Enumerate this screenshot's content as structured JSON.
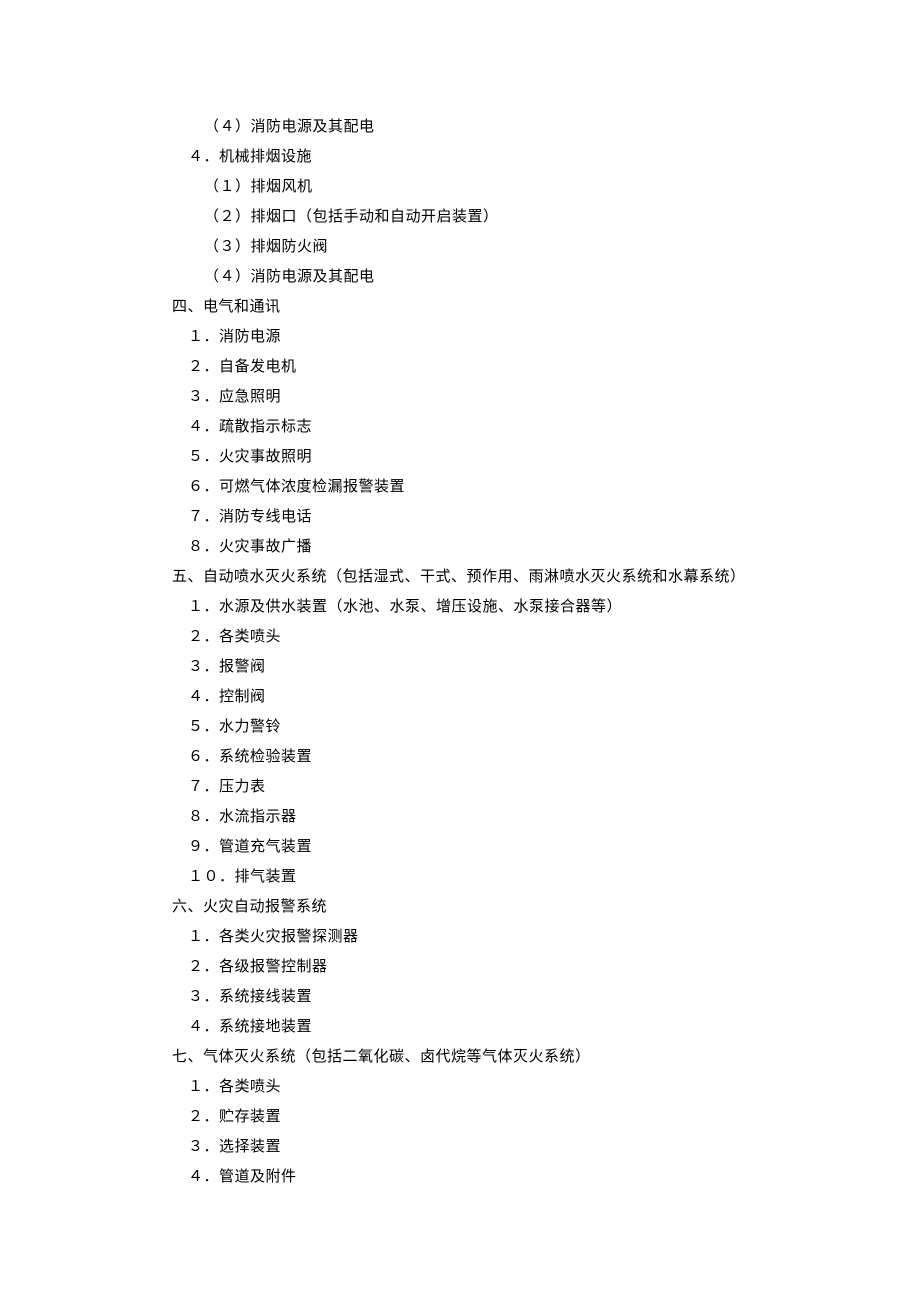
{
  "lines": [
    {
      "indent": 2,
      "text": "（４）消防电源及其配电"
    },
    {
      "indent": 1,
      "text": "４．机械排烟设施"
    },
    {
      "indent": 2,
      "text": "（１）排烟风机"
    },
    {
      "indent": 2,
      "text": "（２）排烟口（包括手动和自动开启装置）"
    },
    {
      "indent": 2,
      "text": "（３）排烟防火阀"
    },
    {
      "indent": 2,
      "text": "（４）消防电源及其配电"
    },
    {
      "indent": 0,
      "text": "四、电气和通讯"
    },
    {
      "indent": 1,
      "text": "１．消防电源"
    },
    {
      "indent": 1,
      "text": "２．自备发电机"
    },
    {
      "indent": 1,
      "text": "３．应急照明"
    },
    {
      "indent": 1,
      "text": "４．疏散指示标志"
    },
    {
      "indent": 1,
      "text": "５．火灾事故照明"
    },
    {
      "indent": 1,
      "text": "６．可燃气体浓度检漏报警装置"
    },
    {
      "indent": 1,
      "text": "７．消防专线电话"
    },
    {
      "indent": 1,
      "text": "８．火灾事故广播"
    },
    {
      "indent": 0,
      "text": "五、自动喷水灭火系统（包括湿式、干式、预作用、雨淋喷水灭火系统和水幕系统）"
    },
    {
      "indent": 1,
      "text": "１．水源及供水装置（水池、水泵、增压设施、水泵接合器等）"
    },
    {
      "indent": 1,
      "text": "２．各类喷头"
    },
    {
      "indent": 1,
      "text": "３．报警阀"
    },
    {
      "indent": 1,
      "text": "４．控制阀"
    },
    {
      "indent": 1,
      "text": "５．水力警铃"
    },
    {
      "indent": 1,
      "text": "６．系统检验装置"
    },
    {
      "indent": 1,
      "text": "７．压力表"
    },
    {
      "indent": 1,
      "text": "８．水流指示器"
    },
    {
      "indent": 1,
      "text": "９．管道充气装置"
    },
    {
      "indent": 1,
      "text": "１０．排气装置"
    },
    {
      "indent": 0,
      "text": "六、火灾自动报警系统"
    },
    {
      "indent": 1,
      "text": "１．各类火灾报警探测器"
    },
    {
      "indent": 1,
      "text": "２．各级报警控制器"
    },
    {
      "indent": 1,
      "text": "３．系统接线装置"
    },
    {
      "indent": 1,
      "text": "４．系统接地装置"
    },
    {
      "indent": 0,
      "text": "七、气体灭火系统（包括二氧化碳、卤代烷等气体灭火系统）"
    },
    {
      "indent": 1,
      "text": "１．各类喷头"
    },
    {
      "indent": 1,
      "text": "２．贮存装置"
    },
    {
      "indent": 1,
      "text": "３．选择装置"
    },
    {
      "indent": 1,
      "text": "４．管道及附件"
    }
  ]
}
